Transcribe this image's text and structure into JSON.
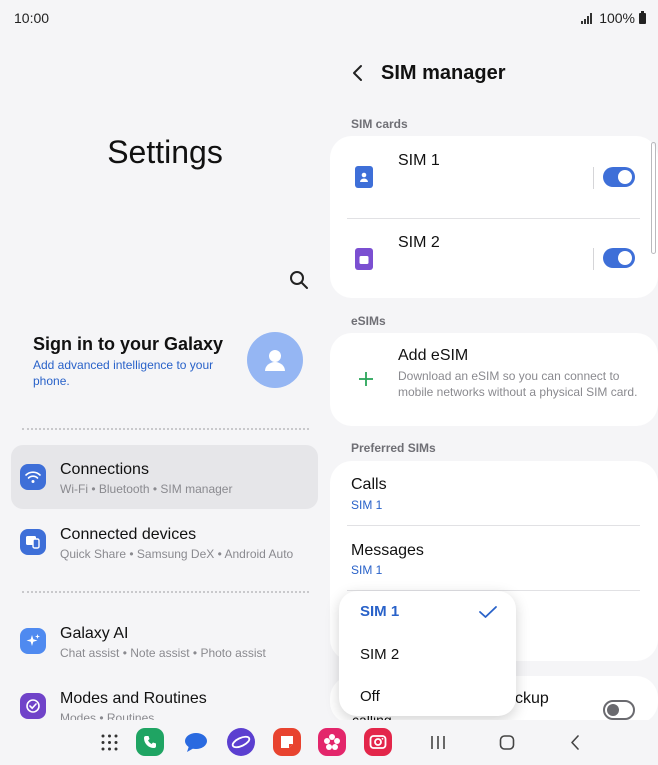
{
  "status": {
    "time": "10:00",
    "battery": "100%"
  },
  "left": {
    "title": "Settings",
    "signin_title": "Sign in to your Galaxy",
    "signin_sub": "Add advanced intelligence to your phone.",
    "items": [
      {
        "label": "Connections",
        "sub": "Wi-Fi  •  Bluetooth  •  SIM manager",
        "icon": "wifi-icon",
        "color": "#3e6fd8"
      },
      {
        "label": "Connected devices",
        "sub": "Quick Share  •  Samsung DeX  •  Android Auto",
        "icon": "devices-icon",
        "color": "#3e6fd8"
      },
      {
        "label": "Galaxy AI",
        "sub": "Chat assist  •  Note assist  •  Photo assist",
        "icon": "sparkle-icon",
        "color": "#4f8af0"
      },
      {
        "label": "Modes and Routines",
        "sub": "Modes  •  Routines",
        "icon": "check-circle-icon",
        "color": "#7043c9"
      }
    ]
  },
  "right": {
    "title": "SIM manager",
    "sim_cards_label": "SIM cards",
    "sim1": "SIM 1",
    "sim2": "SIM 2",
    "esims_label": "eSIMs",
    "add_esim": "Add eSIM",
    "add_esim_sub": "Download an eSIM so you can connect to mobile networks without a physical SIM card.",
    "preferred_label": "Preferred SIMs",
    "calls_label": "Calls",
    "calls_value": "SIM 1",
    "messages_label": "Messages",
    "messages_value": "SIM 1",
    "backup_partial": "ckup",
    "calling_partial": "calling"
  },
  "popup": {
    "options": [
      "SIM 1",
      "SIM 2",
      "Off"
    ],
    "selected": "SIM 1"
  },
  "colors": {
    "accent": "#3e6fd8",
    "sim1": "#3e6fd8",
    "sim2": "#7b4fd1",
    "link": "#2962c9"
  }
}
